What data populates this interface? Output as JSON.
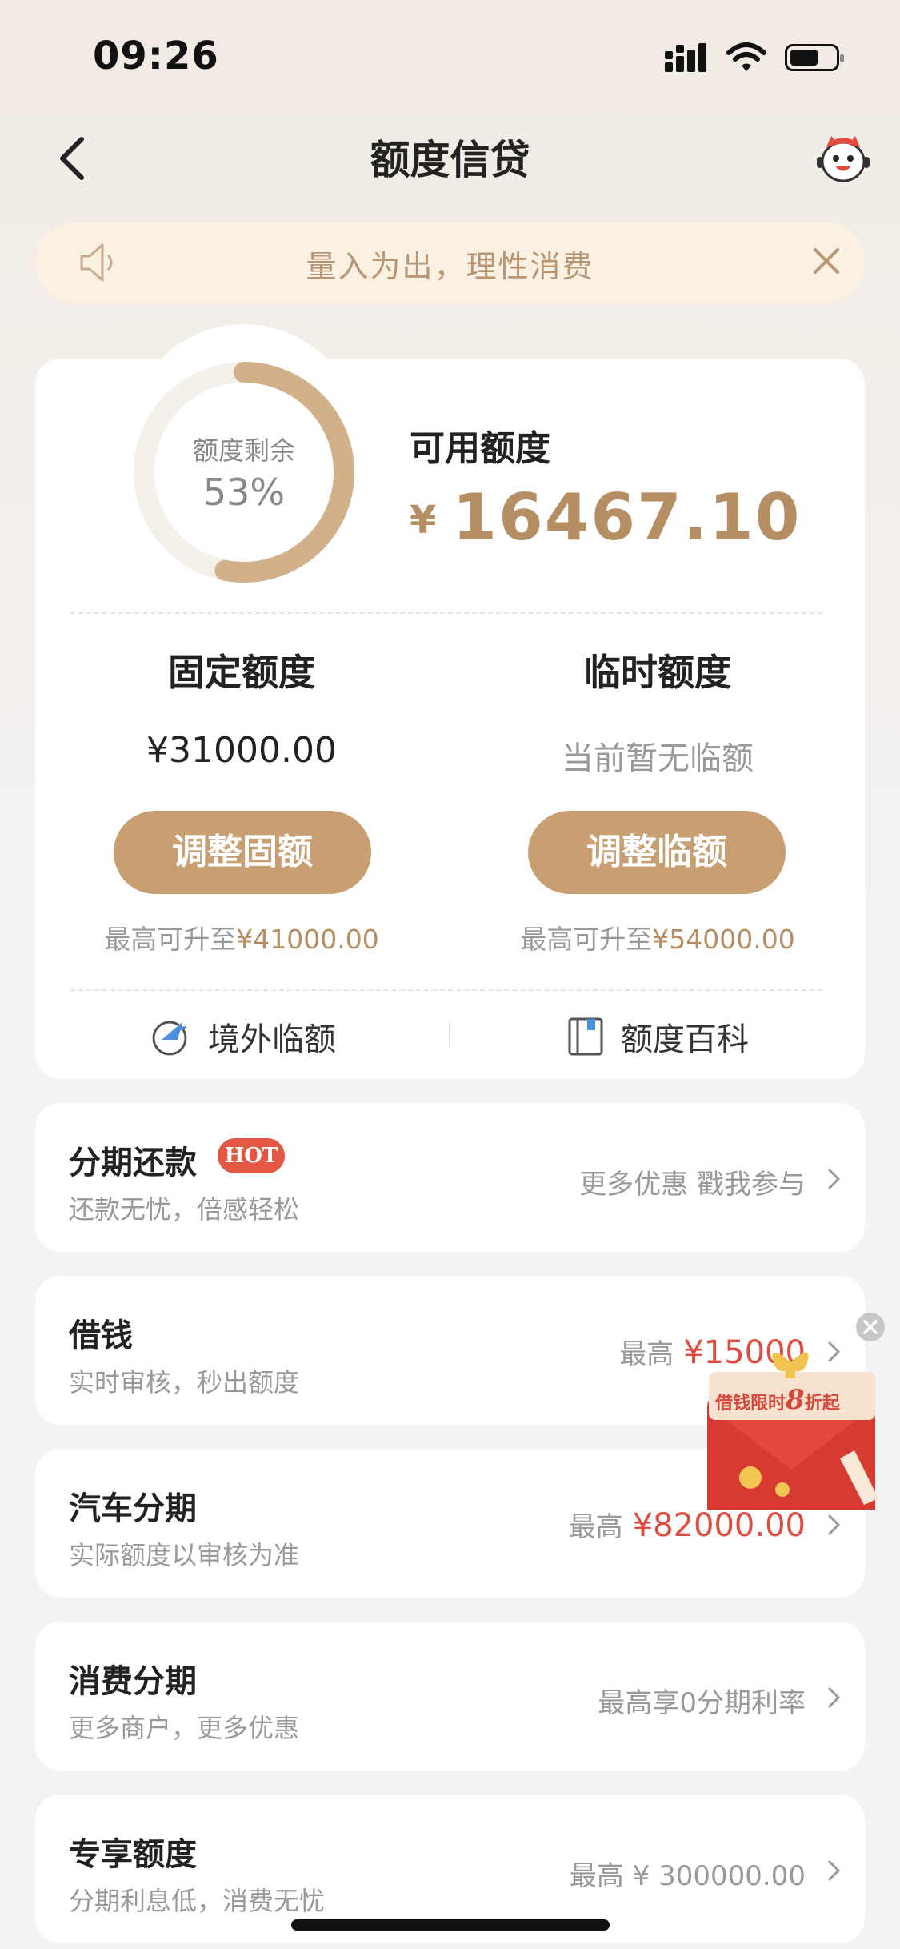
{
  "status_bar": {
    "time": "09:26"
  },
  "header": {
    "title": "额度信贷"
  },
  "notice": {
    "text": "量入为出，理性消费"
  },
  "credit": {
    "ring_label": "额度剩余",
    "ring_percent_text": "53%",
    "ring_fraction": 0.53,
    "available_label": "可用额度",
    "available_currency": "¥",
    "available_value": "16467.10",
    "fixed": {
      "title": "固定额度",
      "value": "¥31000.00",
      "button": "调整固额",
      "note_prefix": "最高可升至",
      "note_amount": "¥41000.00"
    },
    "temp": {
      "title": "临时额度",
      "value": "当前暂无临额",
      "button": "调整临额",
      "note_prefix": "最高可升至",
      "note_amount": "¥54000.00"
    },
    "links": {
      "overseas": "境外临额",
      "wiki": "额度百科"
    }
  },
  "rows": [
    {
      "title": "分期还款",
      "badge": "HOT",
      "subtitle": "还款无忧，倍感轻松",
      "right": "更多优惠 戳我参与",
      "amount": ""
    },
    {
      "title": "借钱",
      "subtitle": "实时审核，秒出额度",
      "right": "最高",
      "amount": "¥15000"
    },
    {
      "title": "汽车分期",
      "subtitle": "实际额度以审核为准",
      "right": "最高",
      "amount": "¥82000.00"
    },
    {
      "title": "消费分期",
      "subtitle": "更多商户，更多优惠",
      "right": "最高享0分期利率",
      "amount": ""
    },
    {
      "title": "专享额度",
      "subtitle": "分期利息低，消费无忧",
      "right": "最高 ¥ 300000.00",
      "amount": ""
    }
  ],
  "promo": {
    "text_prefix": "借钱限时",
    "text_num": "8",
    "text_suffix": "折起"
  },
  "colors": {
    "gold": "#c79f72",
    "gold_text": "#b58f63",
    "red": "#e04a3f",
    "notice_bg": "#fbf1e3"
  }
}
